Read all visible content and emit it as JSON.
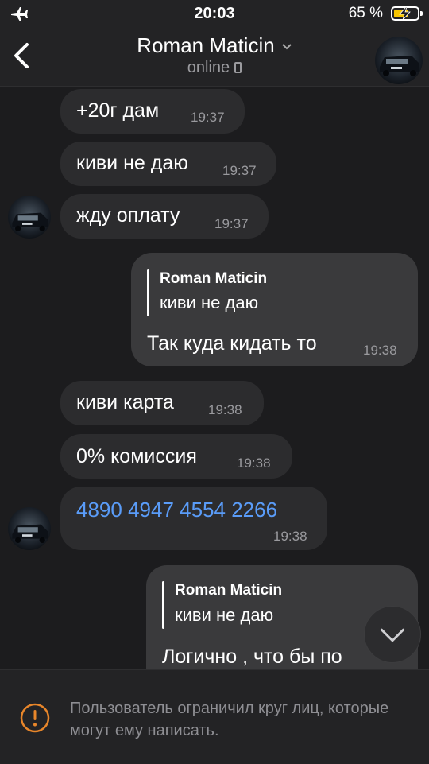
{
  "status_bar": {
    "time": "20:03",
    "battery": "65 %",
    "battery_level": 0.65
  },
  "header": {
    "title": "Roman Maticin",
    "subtitle": "online"
  },
  "messages": [
    {
      "text": "+20г дам",
      "time": "19:37"
    },
    {
      "text": "киви не даю",
      "time": "19:37"
    },
    {
      "text": "жду оплату",
      "time": "19:37"
    },
    {
      "reply_name": "Roman Maticin",
      "reply_text": "киви не даю",
      "text": "Так куда кидать то",
      "time": "19:38"
    },
    {
      "text": "киви карта",
      "time": "19:38"
    },
    {
      "text": "0% комиссия",
      "time": "19:38"
    },
    {
      "text": "4890 4947 4554 2266",
      "time": "19:38"
    },
    {
      "reply_name": "Roman Maticin",
      "reply_text": "киви не даю",
      "text": "Логично , что бы по"
    }
  ],
  "restriction": {
    "text": "Пользователь ограничил круг лиц, которые могут ему написать."
  },
  "colors": {
    "background": "#1c1c1e",
    "incoming": "#2c2c2e",
    "outgoing": "#3a3a3c",
    "link": "#5a9cf8",
    "warning": "#e8862a",
    "battery": "#f5c400"
  }
}
